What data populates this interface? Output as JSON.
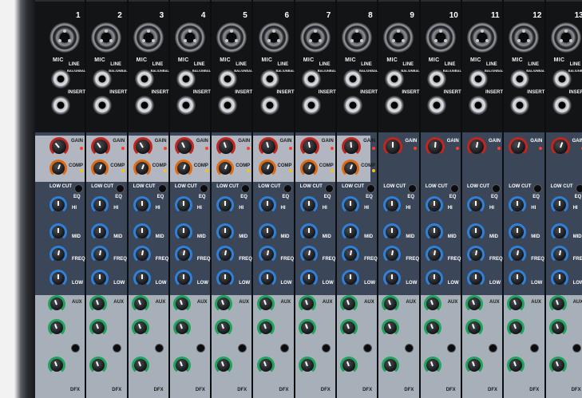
{
  "labels": {
    "mic": "MIC",
    "line": "LINE",
    "line_sub": "BAL/UNBAL",
    "insert": "INSERT",
    "gain": "GAIN",
    "comp": "COMP",
    "low_cut": "LOW CUT",
    "eq": "EQ",
    "hi": "HI",
    "mid": "MID",
    "freq": "FREQ",
    "low": "LOW",
    "aux": "AUX",
    "dfx": "DFX"
  },
  "channels": [
    {
      "number": "1"
    },
    {
      "number": "2"
    },
    {
      "number": "3"
    },
    {
      "number": "4"
    },
    {
      "number": "5"
    },
    {
      "number": "6"
    },
    {
      "number": "7"
    },
    {
      "number": "8"
    },
    {
      "number": "9"
    },
    {
      "number": "10"
    },
    {
      "number": "11"
    },
    {
      "number": "12"
    },
    {
      "number": "13"
    }
  ],
  "colors": {
    "gain_knob": "#c0251e",
    "comp_knob": "#e06a10",
    "eq_knob": "#2f80d8",
    "aux_knob": "#1fa35c",
    "top_panel": "#131416",
    "channel_panel": "#3b4658"
  }
}
